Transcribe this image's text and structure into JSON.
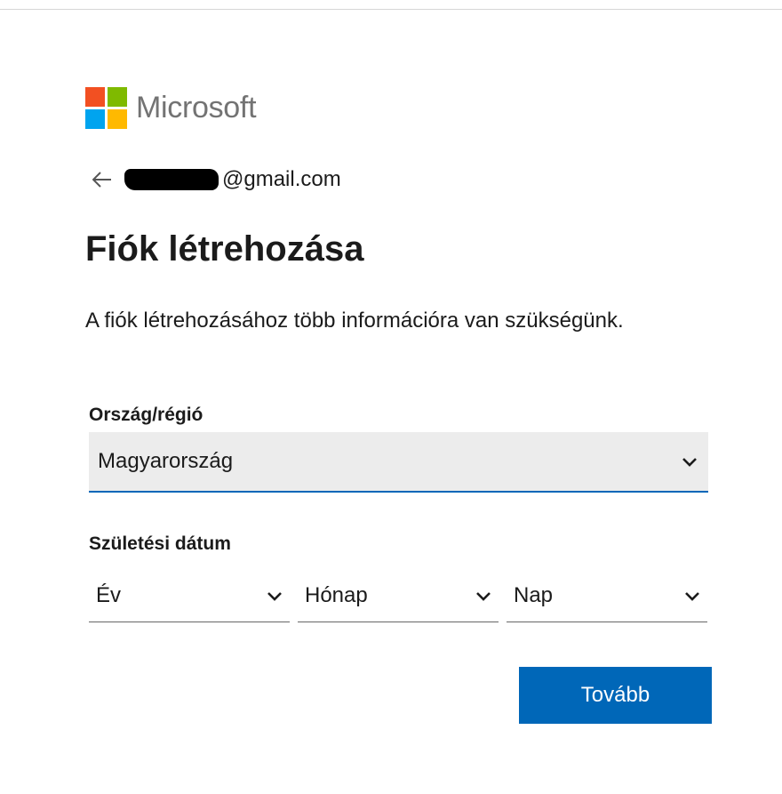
{
  "brand": {
    "name": "Microsoft",
    "colors": {
      "red": "#f25022",
      "green": "#7fba00",
      "blue": "#00a4ef",
      "yellow": "#ffb900"
    }
  },
  "identity": {
    "back_icon": "arrow-left-icon",
    "email_suffix": "@gmail.com"
  },
  "page": {
    "title": "Fiók létrehozása",
    "description": "A fiók létrehozásához több információra van szükségünk."
  },
  "country": {
    "label": "Ország/régió",
    "value": "Magyarország"
  },
  "birthdate": {
    "label": "Születési dátum",
    "year": "Év",
    "month": "Hónap",
    "day": "Nap"
  },
  "actions": {
    "next_label": "Tovább"
  },
  "colors": {
    "accent": "#0067b8",
    "select_background": "#ececec"
  }
}
